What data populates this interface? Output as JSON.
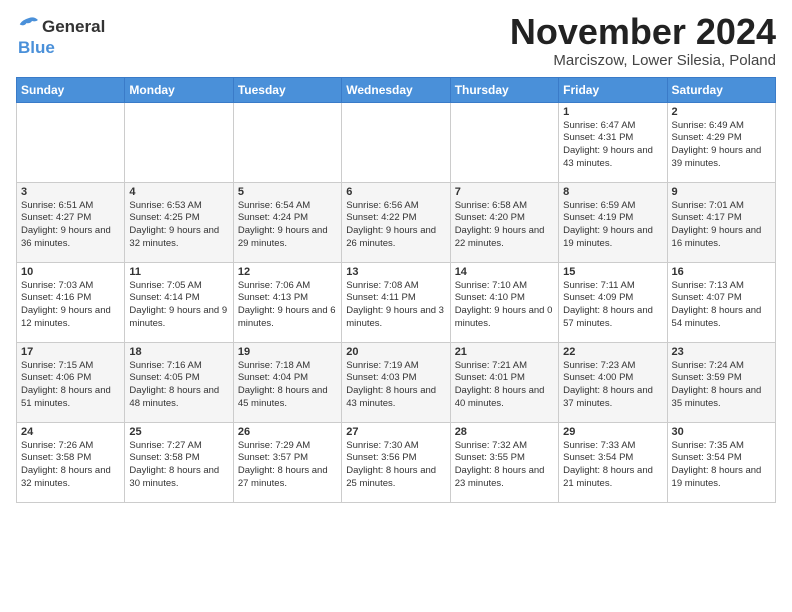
{
  "header": {
    "logo_line1": "General",
    "logo_line2": "Blue",
    "month_title": "November 2024",
    "location": "Marciszow, Lower Silesia, Poland"
  },
  "days_of_week": [
    "Sunday",
    "Monday",
    "Tuesday",
    "Wednesday",
    "Thursday",
    "Friday",
    "Saturday"
  ],
  "weeks": [
    [
      {
        "day": "",
        "content": ""
      },
      {
        "day": "",
        "content": ""
      },
      {
        "day": "",
        "content": ""
      },
      {
        "day": "",
        "content": ""
      },
      {
        "day": "",
        "content": ""
      },
      {
        "day": "1",
        "content": "Sunrise: 6:47 AM\nSunset: 4:31 PM\nDaylight: 9 hours\nand 43 minutes."
      },
      {
        "day": "2",
        "content": "Sunrise: 6:49 AM\nSunset: 4:29 PM\nDaylight: 9 hours\nand 39 minutes."
      }
    ],
    [
      {
        "day": "3",
        "content": "Sunrise: 6:51 AM\nSunset: 4:27 PM\nDaylight: 9 hours\nand 36 minutes."
      },
      {
        "day": "4",
        "content": "Sunrise: 6:53 AM\nSunset: 4:25 PM\nDaylight: 9 hours\nand 32 minutes."
      },
      {
        "day": "5",
        "content": "Sunrise: 6:54 AM\nSunset: 4:24 PM\nDaylight: 9 hours\nand 29 minutes."
      },
      {
        "day": "6",
        "content": "Sunrise: 6:56 AM\nSunset: 4:22 PM\nDaylight: 9 hours\nand 26 minutes."
      },
      {
        "day": "7",
        "content": "Sunrise: 6:58 AM\nSunset: 4:20 PM\nDaylight: 9 hours\nand 22 minutes."
      },
      {
        "day": "8",
        "content": "Sunrise: 6:59 AM\nSunset: 4:19 PM\nDaylight: 9 hours\nand 19 minutes."
      },
      {
        "day": "9",
        "content": "Sunrise: 7:01 AM\nSunset: 4:17 PM\nDaylight: 9 hours\nand 16 minutes."
      }
    ],
    [
      {
        "day": "10",
        "content": "Sunrise: 7:03 AM\nSunset: 4:16 PM\nDaylight: 9 hours\nand 12 minutes."
      },
      {
        "day": "11",
        "content": "Sunrise: 7:05 AM\nSunset: 4:14 PM\nDaylight: 9 hours\nand 9 minutes."
      },
      {
        "day": "12",
        "content": "Sunrise: 7:06 AM\nSunset: 4:13 PM\nDaylight: 9 hours\nand 6 minutes."
      },
      {
        "day": "13",
        "content": "Sunrise: 7:08 AM\nSunset: 4:11 PM\nDaylight: 9 hours\nand 3 minutes."
      },
      {
        "day": "14",
        "content": "Sunrise: 7:10 AM\nSunset: 4:10 PM\nDaylight: 9 hours\nand 0 minutes."
      },
      {
        "day": "15",
        "content": "Sunrise: 7:11 AM\nSunset: 4:09 PM\nDaylight: 8 hours\nand 57 minutes."
      },
      {
        "day": "16",
        "content": "Sunrise: 7:13 AM\nSunset: 4:07 PM\nDaylight: 8 hours\nand 54 minutes."
      }
    ],
    [
      {
        "day": "17",
        "content": "Sunrise: 7:15 AM\nSunset: 4:06 PM\nDaylight: 8 hours\nand 51 minutes."
      },
      {
        "day": "18",
        "content": "Sunrise: 7:16 AM\nSunset: 4:05 PM\nDaylight: 8 hours\nand 48 minutes."
      },
      {
        "day": "19",
        "content": "Sunrise: 7:18 AM\nSunset: 4:04 PM\nDaylight: 8 hours\nand 45 minutes."
      },
      {
        "day": "20",
        "content": "Sunrise: 7:19 AM\nSunset: 4:03 PM\nDaylight: 8 hours\nand 43 minutes."
      },
      {
        "day": "21",
        "content": "Sunrise: 7:21 AM\nSunset: 4:01 PM\nDaylight: 8 hours\nand 40 minutes."
      },
      {
        "day": "22",
        "content": "Sunrise: 7:23 AM\nSunset: 4:00 PM\nDaylight: 8 hours\nand 37 minutes."
      },
      {
        "day": "23",
        "content": "Sunrise: 7:24 AM\nSunset: 3:59 PM\nDaylight: 8 hours\nand 35 minutes."
      }
    ],
    [
      {
        "day": "24",
        "content": "Sunrise: 7:26 AM\nSunset: 3:58 PM\nDaylight: 8 hours\nand 32 minutes."
      },
      {
        "day": "25",
        "content": "Sunrise: 7:27 AM\nSunset: 3:58 PM\nDaylight: 8 hours\nand 30 minutes."
      },
      {
        "day": "26",
        "content": "Sunrise: 7:29 AM\nSunset: 3:57 PM\nDaylight: 8 hours\nand 27 minutes."
      },
      {
        "day": "27",
        "content": "Sunrise: 7:30 AM\nSunset: 3:56 PM\nDaylight: 8 hours\nand 25 minutes."
      },
      {
        "day": "28",
        "content": "Sunrise: 7:32 AM\nSunset: 3:55 PM\nDaylight: 8 hours\nand 23 minutes."
      },
      {
        "day": "29",
        "content": "Sunrise: 7:33 AM\nSunset: 3:54 PM\nDaylight: 8 hours\nand 21 minutes."
      },
      {
        "day": "30",
        "content": "Sunrise: 7:35 AM\nSunset: 3:54 PM\nDaylight: 8 hours\nand 19 minutes."
      }
    ]
  ]
}
